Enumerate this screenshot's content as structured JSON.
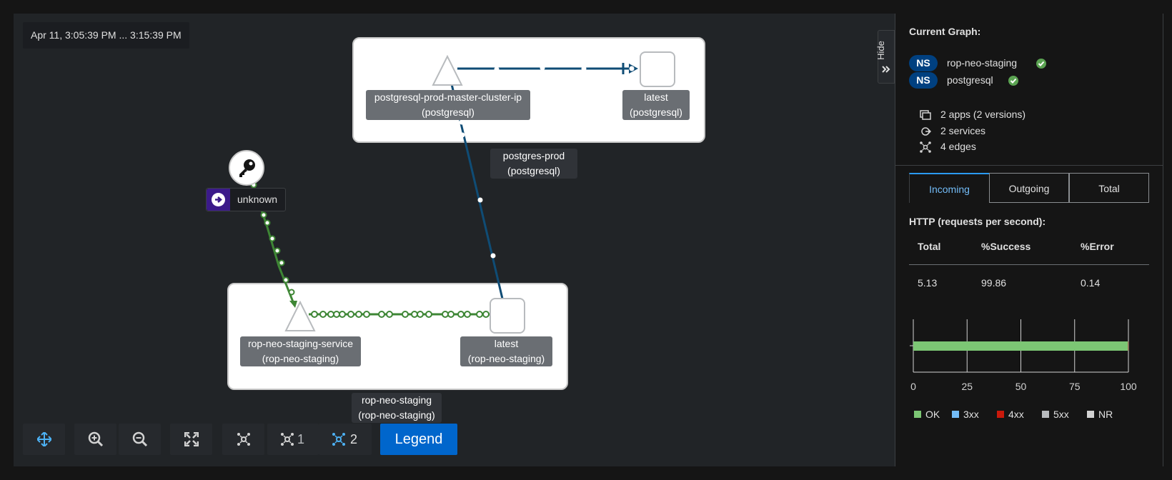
{
  "time_range": "Apr 11, 3:05:39 PM ... 3:15:39 PM",
  "graph": {
    "nodes": {
      "postgres_service": {
        "name": "postgresql-prod-master-cluster-ip",
        "ns": "(postgresql)"
      },
      "postgres_workload": {
        "name": "latest",
        "ns": "(postgresql)"
      },
      "neo_service": {
        "name": "rop-neo-staging-service",
        "ns": "(rop-neo-staging)"
      },
      "neo_workload": {
        "name": "latest",
        "ns": "(rop-neo-staging)"
      },
      "unknown": {
        "name": "unknown"
      }
    },
    "app_labels": {
      "postgres_app": {
        "name": "postgres-prod",
        "ns": "(postgresql)"
      },
      "neo_app": {
        "name": "rop-neo-staging",
        "ns": "(rop-neo-staging)"
      }
    }
  },
  "toolbar": {
    "layout1_count": "1",
    "layout2_count": "2",
    "legend_label": "Legend"
  },
  "side_panel": {
    "hide_label": "Hide",
    "title": "Current Graph:",
    "namespaces": [
      {
        "badge": "NS",
        "name": "rop-neo-staging",
        "healthy": true
      },
      {
        "badge": "NS",
        "name": "postgresql",
        "healthy": true
      }
    ],
    "stats": {
      "apps": "2 apps (2 versions)",
      "services": "2 services",
      "edges": "4 edges"
    },
    "tabs": [
      "Incoming",
      "Outgoing",
      "Total"
    ],
    "active_tab": "Incoming",
    "http_title": "HTTP (requests per second):",
    "table": {
      "headers": [
        "Total",
        "%Success",
        "%Error"
      ],
      "row": [
        "5.13",
        "99.86",
        "0.14"
      ]
    },
    "chart_data": {
      "type": "bar",
      "orientation": "horizontal",
      "categories": [
        ""
      ],
      "series": [
        {
          "name": "OK",
          "values": [
            99.86
          ]
        },
        {
          "name": "4xx",
          "values": [
            0.14
          ]
        }
      ],
      "xlim": [
        0,
        100
      ],
      "xticks": [
        "0",
        "25",
        "50",
        "75",
        "100"
      ],
      "legend": [
        "OK",
        "3xx",
        "4xx",
        "5xx",
        "NR"
      ],
      "legend_colors": [
        "#7cc674",
        "#73bcf7",
        "#c9190b",
        "#b8bbbe",
        "#d2d2d2"
      ],
      "grid": true,
      "legend_position": "bottom"
    }
  },
  "colors": {
    "edge_blue": "#0f4c75",
    "edge_green": "#3e8635",
    "ok_green": "#7cc674",
    "accent": "#0066cc"
  }
}
